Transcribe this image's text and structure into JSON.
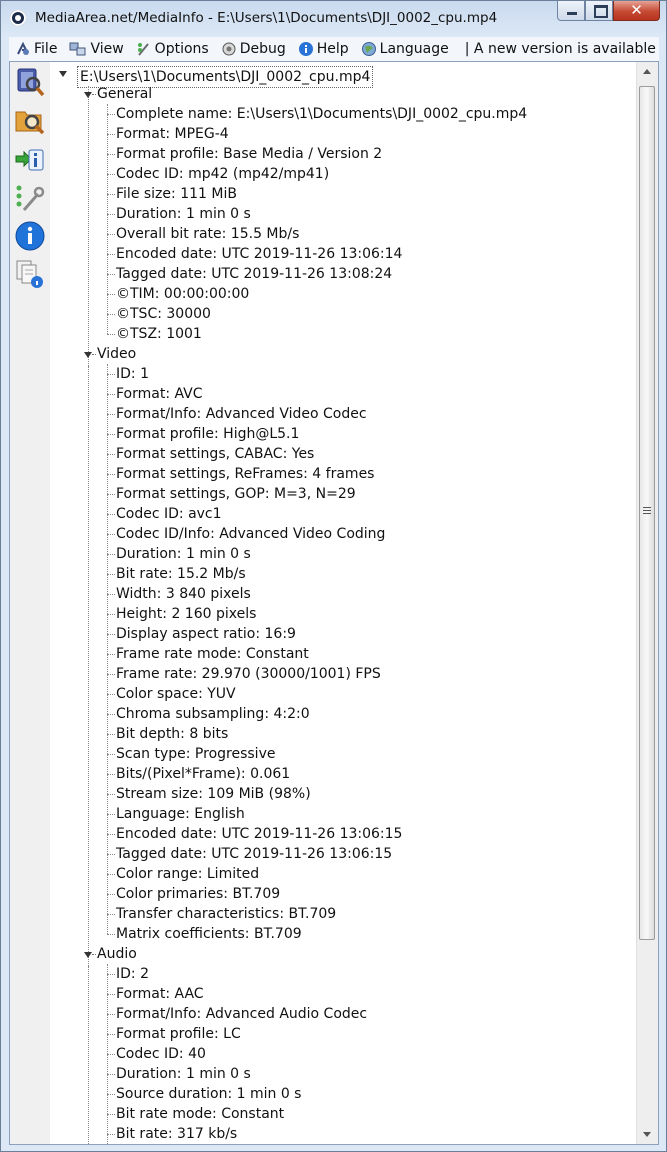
{
  "window": {
    "title": "MediaArea.net/MediaInfo - E:\\Users\\1\\Documents\\DJI_0002_cpu.mp4",
    "close_glyph": "✕"
  },
  "menu": {
    "items": [
      {
        "label": "File",
        "icon": "file-icon"
      },
      {
        "label": "View",
        "icon": "view-icon"
      },
      {
        "label": "Options",
        "icon": "options-icon"
      },
      {
        "label": "Debug",
        "icon": "debug-icon"
      },
      {
        "label": "Help",
        "icon": "help-icon"
      },
      {
        "label": "Language",
        "icon": "language-icon"
      }
    ],
    "notice": "| A new version is available"
  },
  "toolbar": {
    "buttons": [
      "open-file-icon",
      "open-folder-icon",
      "export-icon",
      "preferences-icon",
      "about-icon",
      "sheet-view-icon"
    ]
  },
  "tree": {
    "root": "E:\\Users\\1\\Documents\\DJI_0002_cpu.mp4",
    "sections": [
      {
        "name": "General",
        "fields": [
          "Complete name: E:\\Users\\1\\Documents\\DJI_0002_cpu.mp4",
          "Format: MPEG-4",
          "Format profile: Base Media / Version 2",
          "Codec ID: mp42 (mp42/mp41)",
          "File size: 111 MiB",
          "Duration: 1 min 0 s",
          "Overall bit rate: 15.5 Mb/s",
          "Encoded date: UTC 2019-11-26 13:06:14",
          "Tagged date: UTC 2019-11-26 13:08:24",
          "©TIM: 00:00:00:00",
          "©TSC: 30000",
          "©TSZ: 1001"
        ]
      },
      {
        "name": "Video",
        "fields": [
          "ID: 1",
          "Format: AVC",
          "Format/Info: Advanced Video Codec",
          "Format profile: High@L5.1",
          "Format settings, CABAC: Yes",
          "Format settings, ReFrames: 4 frames",
          "Format settings, GOP: M=3, N=29",
          "Codec ID: avc1",
          "Codec ID/Info: Advanced Video Coding",
          "Duration: 1 min 0 s",
          "Bit rate: 15.2 Mb/s",
          "Width: 3 840 pixels",
          "Height: 2 160 pixels",
          "Display aspect ratio: 16:9",
          "Frame rate mode: Constant",
          "Frame rate: 29.970 (30000/1001) FPS",
          "Color space: YUV",
          "Chroma subsampling: 4:2:0",
          "Bit depth: 8 bits",
          "Scan type: Progressive",
          "Bits/(Pixel*Frame): 0.061",
          "Stream size: 109 MiB (98%)",
          "Language: English",
          "Encoded date: UTC 2019-11-26 13:06:15",
          "Tagged date: UTC 2019-11-26 13:06:15",
          "Color range: Limited",
          "Color primaries: BT.709",
          "Transfer characteristics: BT.709",
          "Matrix coefficients: BT.709"
        ]
      },
      {
        "name": "Audio",
        "fields": [
          "ID: 2",
          "Format: AAC",
          "Format/Info: Advanced Audio Codec",
          "Format profile: LC",
          "Codec ID: 40",
          "Duration: 1 min 0 s",
          "Source duration: 1 min 0 s",
          "Bit rate mode: Constant",
          "Bit rate: 317 kb/s"
        ]
      }
    ]
  }
}
